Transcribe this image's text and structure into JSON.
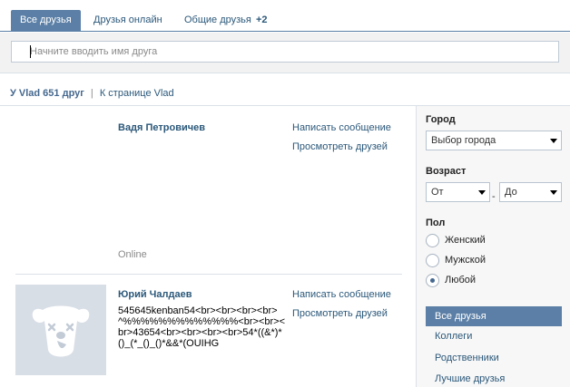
{
  "tabs": [
    {
      "label": "Все друзья",
      "active": true
    },
    {
      "label": "Друзья онлайн",
      "active": false
    },
    {
      "label": "Общие друзья",
      "count": "+2",
      "active": false
    }
  ],
  "search": {
    "placeholder": "Начните вводить имя друга",
    "value": ""
  },
  "summary": {
    "count_text": "У Vlad 651 друг",
    "separator": "|",
    "page_link": "К странице Vlad"
  },
  "friends": [
    {
      "name": "Вадя Петровичев",
      "status": "",
      "online": "Online",
      "actions": [
        "Написать сообщение",
        "Просмотреть друзей"
      ]
    },
    {
      "name": "Юрий Чалдаев",
      "status": "545645kenban54<br><br><br><br>^%%%%%%%%%%%%%<br><br><br>43654<br><br><br><br>54*((&*)*()_(*_()_()*&&*(OUIHG",
      "online": "",
      "avatar_icon": "dog-placeholder-icon",
      "actions": [
        "Написать сообщение",
        "Просмотреть друзей"
      ]
    }
  ],
  "filters": {
    "city": {
      "label": "Город",
      "selected": "Выбор города"
    },
    "age": {
      "label": "Возраст",
      "from": "От",
      "separator": "-",
      "to": "До"
    },
    "gender": {
      "label": "Пол",
      "options": [
        {
          "label": "Женский",
          "checked": false
        },
        {
          "label": "Мужской",
          "checked": false
        },
        {
          "label": "Любой",
          "checked": true
        }
      ]
    }
  },
  "categories": [
    {
      "label": "Все друзья",
      "active": true
    },
    {
      "label": "Коллеги",
      "active": false
    },
    {
      "label": "Родственники",
      "active": false
    },
    {
      "label": "Лучшие друзья",
      "active": false
    }
  ],
  "colors": {
    "accent": "#5b7fa6",
    "link": "#2b587a",
    "avatar_bg": "#d8dee6"
  }
}
